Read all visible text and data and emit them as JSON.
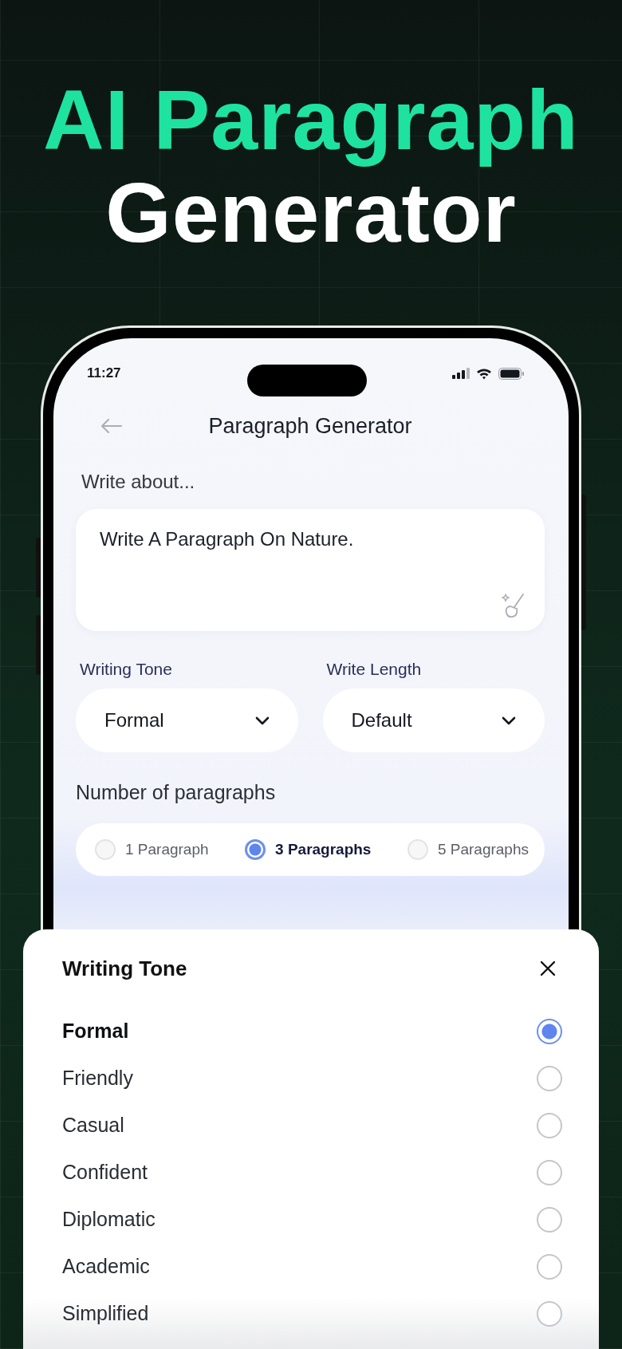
{
  "headline": {
    "line_1": "AI Paragraph",
    "line_2": "Generator"
  },
  "status_bar": {
    "time": "11:27"
  },
  "screen": {
    "title": "Paragraph Generator",
    "prompt_label": "Write about...",
    "prompt_value": "Write A Paragraph On Nature.",
    "dropdowns": [
      {
        "label": "Writing Tone",
        "value": "Formal"
      },
      {
        "label": "Write Length",
        "value": "Default"
      }
    ],
    "paragraph_count_label": "Number of paragraphs",
    "paragraph_options": [
      {
        "label": "1 Paragraph",
        "selected": false
      },
      {
        "label": "3 Paragraphs",
        "selected": true
      },
      {
        "label": "5 Paragraphs",
        "selected": false
      }
    ]
  },
  "sheet": {
    "title": "Writing Tone",
    "options": [
      {
        "label": "Formal",
        "selected": true
      },
      {
        "label": "Friendly",
        "selected": false
      },
      {
        "label": "Casual",
        "selected": false
      },
      {
        "label": "Confident",
        "selected": false
      },
      {
        "label": "Diplomatic",
        "selected": false
      },
      {
        "label": "Academic",
        "selected": false
      },
      {
        "label": "Simplified",
        "selected": false
      }
    ]
  }
}
